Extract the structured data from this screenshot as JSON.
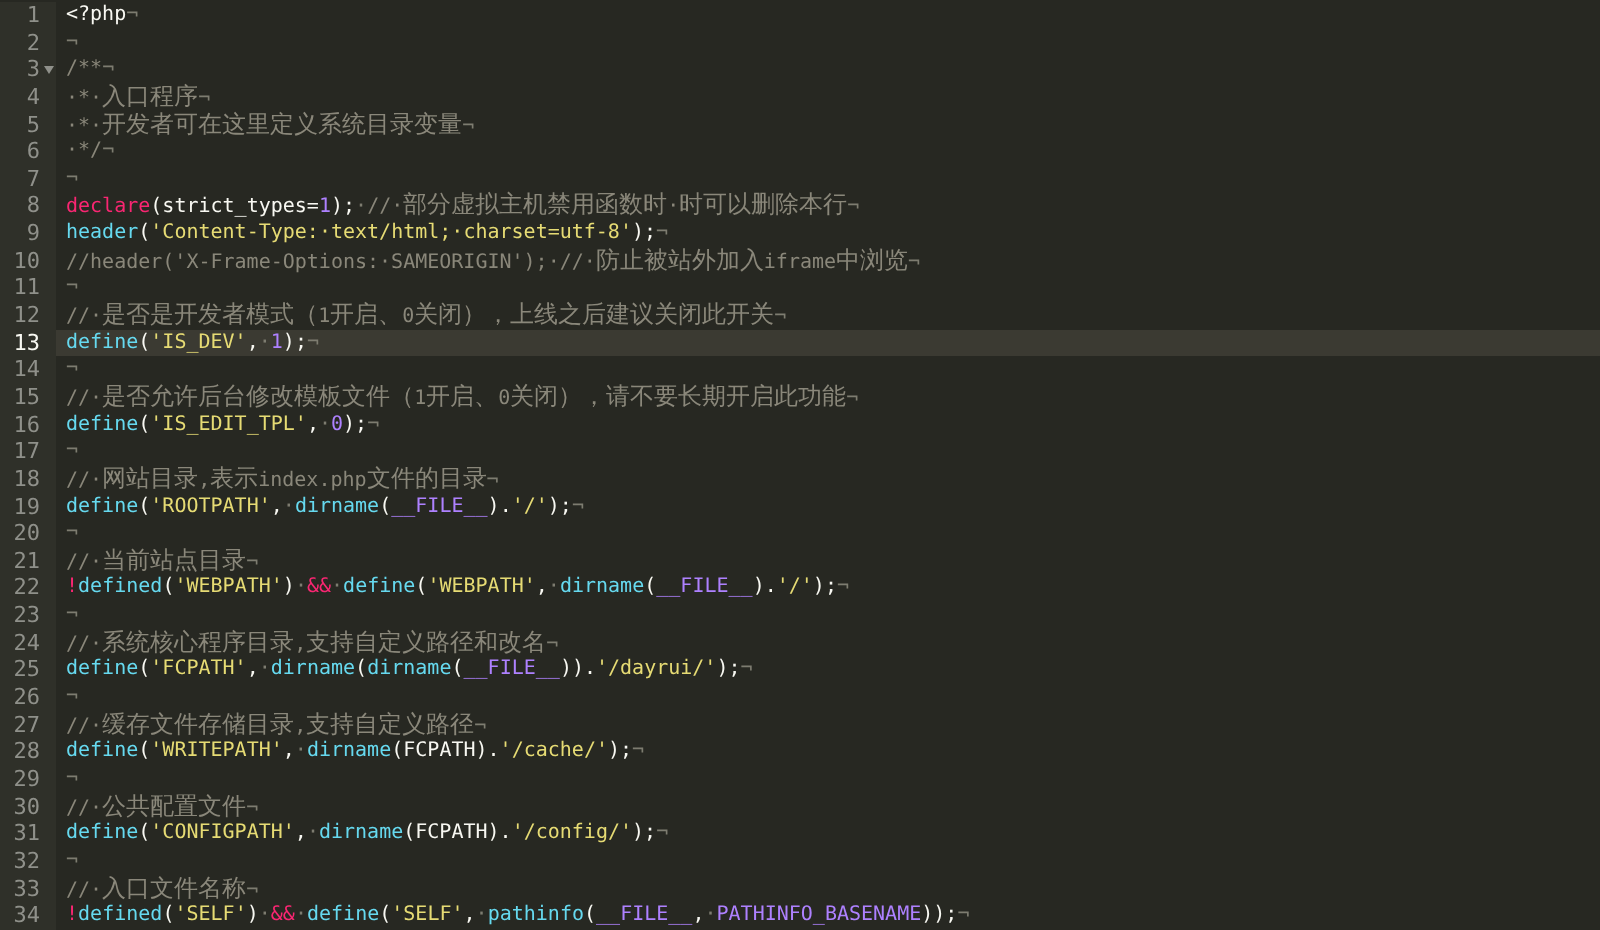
{
  "editor": {
    "lines": [
      {
        "number": "1",
        "selected": false,
        "fold": false,
        "tokens": [
          {
            "kind": "plain",
            "text": "<?php"
          },
          {
            "kind": "ws",
            "text": "¬"
          }
        ]
      },
      {
        "number": "2",
        "selected": false,
        "fold": false,
        "tokens": [
          {
            "kind": "ws",
            "text": "¬"
          }
        ]
      },
      {
        "number": "3",
        "selected": false,
        "fold": true,
        "tokens": [
          {
            "kind": "comment",
            "text": "/**"
          },
          {
            "kind": "ws",
            "text": "¬"
          }
        ]
      },
      {
        "number": "4",
        "selected": false,
        "fold": false,
        "tokens": [
          {
            "kind": "comment",
            "text": "·*·入口程序"
          },
          {
            "kind": "ws",
            "text": "¬"
          }
        ]
      },
      {
        "number": "5",
        "selected": false,
        "fold": false,
        "tokens": [
          {
            "kind": "comment",
            "text": "·*·开发者可在这里定义系统目录变量"
          },
          {
            "kind": "ws",
            "text": "¬"
          }
        ]
      },
      {
        "number": "6",
        "selected": false,
        "fold": false,
        "tokens": [
          {
            "kind": "comment",
            "text": "·*/"
          },
          {
            "kind": "ws",
            "text": "¬"
          }
        ]
      },
      {
        "number": "7",
        "selected": false,
        "fold": false,
        "tokens": [
          {
            "kind": "ws",
            "text": "¬"
          }
        ]
      },
      {
        "number": "8",
        "selected": false,
        "fold": false,
        "tokens": [
          {
            "kind": "keyword",
            "text": "declare"
          },
          {
            "kind": "plain",
            "text": "(strict_types="
          },
          {
            "kind": "number",
            "text": "1"
          },
          {
            "kind": "plain",
            "text": ");"
          },
          {
            "kind": "ws",
            "text": "·"
          },
          {
            "kind": "comment",
            "text": "//·部分虚拟主机禁用函数时·时可以删除本行"
          },
          {
            "kind": "ws",
            "text": "¬"
          }
        ]
      },
      {
        "number": "9",
        "selected": false,
        "fold": false,
        "tokens": [
          {
            "kind": "func",
            "text": "header"
          },
          {
            "kind": "plain",
            "text": "("
          },
          {
            "kind": "string",
            "text": "'Content-Type:·text/html;·charset=utf-8'"
          },
          {
            "kind": "plain",
            "text": ");"
          },
          {
            "kind": "ws",
            "text": "¬"
          }
        ]
      },
      {
        "number": "10",
        "selected": false,
        "fold": false,
        "tokens": [
          {
            "kind": "comment",
            "text": "//header('X-Frame-Options:·SAMEORIGIN');·//·防止被站外加入iframe中浏览"
          },
          {
            "kind": "ws",
            "text": "¬"
          }
        ]
      },
      {
        "number": "11",
        "selected": false,
        "fold": false,
        "tokens": [
          {
            "kind": "ws",
            "text": "¬"
          }
        ]
      },
      {
        "number": "12",
        "selected": false,
        "fold": false,
        "tokens": [
          {
            "kind": "comment",
            "text": "//·是否是开发者模式（1开启、0关闭），上线之后建议关闭此开关"
          },
          {
            "kind": "ws",
            "text": "¬"
          }
        ]
      },
      {
        "number": "13",
        "selected": true,
        "fold": false,
        "tokens": [
          {
            "kind": "func",
            "text": "define"
          },
          {
            "kind": "plain",
            "text": "("
          },
          {
            "kind": "string",
            "text": "'IS_DEV'"
          },
          {
            "kind": "plain",
            "text": ","
          },
          {
            "kind": "ws",
            "text": "·"
          },
          {
            "kind": "number",
            "text": "1"
          },
          {
            "kind": "plain",
            "text": ");"
          },
          {
            "kind": "ws",
            "text": "¬"
          }
        ]
      },
      {
        "number": "14",
        "selected": false,
        "fold": false,
        "tokens": [
          {
            "kind": "ws",
            "text": "¬"
          }
        ]
      },
      {
        "number": "15",
        "selected": false,
        "fold": false,
        "tokens": [
          {
            "kind": "comment",
            "text": "//·是否允许后台修改模板文件（1开启、0关闭），请不要长期开启此功能"
          },
          {
            "kind": "ws",
            "text": "¬"
          }
        ]
      },
      {
        "number": "16",
        "selected": false,
        "fold": false,
        "tokens": [
          {
            "kind": "func",
            "text": "define"
          },
          {
            "kind": "plain",
            "text": "("
          },
          {
            "kind": "string",
            "text": "'IS_EDIT_TPL'"
          },
          {
            "kind": "plain",
            "text": ","
          },
          {
            "kind": "ws",
            "text": "·"
          },
          {
            "kind": "number",
            "text": "0"
          },
          {
            "kind": "plain",
            "text": ");"
          },
          {
            "kind": "ws",
            "text": "¬"
          }
        ]
      },
      {
        "number": "17",
        "selected": false,
        "fold": false,
        "tokens": [
          {
            "kind": "ws",
            "text": "¬"
          }
        ]
      },
      {
        "number": "18",
        "selected": false,
        "fold": false,
        "tokens": [
          {
            "kind": "comment",
            "text": "//·网站目录,表示index.php文件的目录"
          },
          {
            "kind": "ws",
            "text": "¬"
          }
        ]
      },
      {
        "number": "19",
        "selected": false,
        "fold": false,
        "tokens": [
          {
            "kind": "func",
            "text": "define"
          },
          {
            "kind": "plain",
            "text": "("
          },
          {
            "kind": "string",
            "text": "'ROOTPATH'"
          },
          {
            "kind": "plain",
            "text": ","
          },
          {
            "kind": "ws",
            "text": "·"
          },
          {
            "kind": "func",
            "text": "dirname"
          },
          {
            "kind": "plain",
            "text": "("
          },
          {
            "kind": "constant",
            "text": "__FILE__"
          },
          {
            "kind": "plain",
            "text": ")."
          },
          {
            "kind": "string",
            "text": "'/'"
          },
          {
            "kind": "plain",
            "text": ");"
          },
          {
            "kind": "ws",
            "text": "¬"
          }
        ]
      },
      {
        "number": "20",
        "selected": false,
        "fold": false,
        "tokens": [
          {
            "kind": "ws",
            "text": "¬"
          }
        ]
      },
      {
        "number": "21",
        "selected": false,
        "fold": false,
        "tokens": [
          {
            "kind": "comment",
            "text": "//·当前站点目录"
          },
          {
            "kind": "ws",
            "text": "¬"
          }
        ]
      },
      {
        "number": "22",
        "selected": false,
        "fold": false,
        "tokens": [
          {
            "kind": "keyword",
            "text": "!"
          },
          {
            "kind": "func",
            "text": "defined"
          },
          {
            "kind": "plain",
            "text": "("
          },
          {
            "kind": "string",
            "text": "'WEBPATH'"
          },
          {
            "kind": "plain",
            "text": ")"
          },
          {
            "kind": "ws",
            "text": "·"
          },
          {
            "kind": "keyword",
            "text": "&&"
          },
          {
            "kind": "ws",
            "text": "·"
          },
          {
            "kind": "func",
            "text": "define"
          },
          {
            "kind": "plain",
            "text": "("
          },
          {
            "kind": "string",
            "text": "'WEBPATH'"
          },
          {
            "kind": "plain",
            "text": ","
          },
          {
            "kind": "ws",
            "text": "·"
          },
          {
            "kind": "func",
            "text": "dirname"
          },
          {
            "kind": "plain",
            "text": "("
          },
          {
            "kind": "constant",
            "text": "__FILE__"
          },
          {
            "kind": "plain",
            "text": ")."
          },
          {
            "kind": "string",
            "text": "'/'"
          },
          {
            "kind": "plain",
            "text": ");"
          },
          {
            "kind": "ws",
            "text": "¬"
          }
        ]
      },
      {
        "number": "23",
        "selected": false,
        "fold": false,
        "tokens": [
          {
            "kind": "ws",
            "text": "¬"
          }
        ]
      },
      {
        "number": "24",
        "selected": false,
        "fold": false,
        "tokens": [
          {
            "kind": "comment",
            "text": "//·系统核心程序目录,支持自定义路径和改名"
          },
          {
            "kind": "ws",
            "text": "¬"
          }
        ]
      },
      {
        "number": "25",
        "selected": false,
        "fold": false,
        "tokens": [
          {
            "kind": "func",
            "text": "define"
          },
          {
            "kind": "plain",
            "text": "("
          },
          {
            "kind": "string",
            "text": "'FCPATH'"
          },
          {
            "kind": "plain",
            "text": ","
          },
          {
            "kind": "ws",
            "text": "·"
          },
          {
            "kind": "func",
            "text": "dirname"
          },
          {
            "kind": "plain",
            "text": "("
          },
          {
            "kind": "func",
            "text": "dirname"
          },
          {
            "kind": "plain",
            "text": "("
          },
          {
            "kind": "constant",
            "text": "__FILE__"
          },
          {
            "kind": "plain",
            "text": "))."
          },
          {
            "kind": "string",
            "text": "'/dayrui/'"
          },
          {
            "kind": "plain",
            "text": ");"
          },
          {
            "kind": "ws",
            "text": "¬"
          }
        ]
      },
      {
        "number": "26",
        "selected": false,
        "fold": false,
        "tokens": [
          {
            "kind": "ws",
            "text": "¬"
          }
        ]
      },
      {
        "number": "27",
        "selected": false,
        "fold": false,
        "tokens": [
          {
            "kind": "comment",
            "text": "//·缓存文件存储目录,支持自定义路径"
          },
          {
            "kind": "ws",
            "text": "¬"
          }
        ]
      },
      {
        "number": "28",
        "selected": false,
        "fold": false,
        "tokens": [
          {
            "kind": "func",
            "text": "define"
          },
          {
            "kind": "plain",
            "text": "("
          },
          {
            "kind": "string",
            "text": "'WRITEPATH'"
          },
          {
            "kind": "plain",
            "text": ","
          },
          {
            "kind": "ws",
            "text": "·"
          },
          {
            "kind": "func",
            "text": "dirname"
          },
          {
            "kind": "plain",
            "text": "(FCPATH)."
          },
          {
            "kind": "string",
            "text": "'/cache/'"
          },
          {
            "kind": "plain",
            "text": ");"
          },
          {
            "kind": "ws",
            "text": "¬"
          }
        ]
      },
      {
        "number": "29",
        "selected": false,
        "fold": false,
        "tokens": [
          {
            "kind": "ws",
            "text": "¬"
          }
        ]
      },
      {
        "number": "30",
        "selected": false,
        "fold": false,
        "tokens": [
          {
            "kind": "comment",
            "text": "//·公共配置文件"
          },
          {
            "kind": "ws",
            "text": "¬"
          }
        ]
      },
      {
        "number": "31",
        "selected": false,
        "fold": false,
        "tokens": [
          {
            "kind": "func",
            "text": "define"
          },
          {
            "kind": "plain",
            "text": "("
          },
          {
            "kind": "string",
            "text": "'CONFIGPATH'"
          },
          {
            "kind": "plain",
            "text": ","
          },
          {
            "kind": "ws",
            "text": "·"
          },
          {
            "kind": "func",
            "text": "dirname"
          },
          {
            "kind": "plain",
            "text": "(FCPATH)."
          },
          {
            "kind": "string",
            "text": "'/config/'"
          },
          {
            "kind": "plain",
            "text": ");"
          },
          {
            "kind": "ws",
            "text": "¬"
          }
        ]
      },
      {
        "number": "32",
        "selected": false,
        "fold": false,
        "tokens": [
          {
            "kind": "ws",
            "text": "¬"
          }
        ]
      },
      {
        "number": "33",
        "selected": false,
        "fold": false,
        "tokens": [
          {
            "kind": "comment",
            "text": "//·入口文件名称"
          },
          {
            "kind": "ws",
            "text": "¬"
          }
        ]
      },
      {
        "number": "34",
        "selected": false,
        "fold": false,
        "tokens": [
          {
            "kind": "keyword",
            "text": "!"
          },
          {
            "kind": "func",
            "text": "defined"
          },
          {
            "kind": "plain",
            "text": "("
          },
          {
            "kind": "string",
            "text": "'SELF'"
          },
          {
            "kind": "plain",
            "text": ")"
          },
          {
            "kind": "ws",
            "text": "·"
          },
          {
            "kind": "keyword",
            "text": "&&"
          },
          {
            "kind": "ws",
            "text": "·"
          },
          {
            "kind": "func",
            "text": "define"
          },
          {
            "kind": "plain",
            "text": "("
          },
          {
            "kind": "string",
            "text": "'SELF'"
          },
          {
            "kind": "plain",
            "text": ","
          },
          {
            "kind": "ws",
            "text": "·"
          },
          {
            "kind": "func",
            "text": "pathinfo"
          },
          {
            "kind": "plain",
            "text": "("
          },
          {
            "kind": "constant",
            "text": "__FILE__"
          },
          {
            "kind": "plain",
            "text": ","
          },
          {
            "kind": "ws",
            "text": "·"
          },
          {
            "kind": "constant",
            "text": "PATHINFO_BASENAME"
          },
          {
            "kind": "plain",
            "text": "));"
          },
          {
            "kind": "ws",
            "text": "¬"
          }
        ]
      }
    ]
  }
}
